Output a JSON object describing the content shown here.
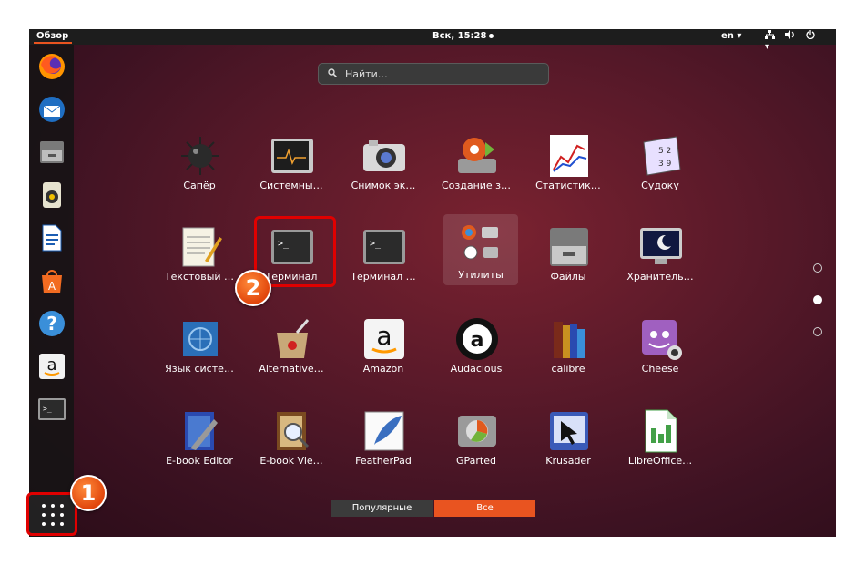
{
  "topbar": {
    "activities": "Обзор",
    "clock": "Вск, 15:28",
    "language": "en ▾",
    "tray_icons": [
      "network-icon",
      "volume-icon",
      "power-icon"
    ]
  },
  "search": {
    "placeholder": "Найти…"
  },
  "dock": {
    "items": [
      "firefox-icon",
      "thunderbird-icon",
      "files-icon",
      "rhythmbox-icon",
      "writer-icon",
      "software-center-icon",
      "help-icon",
      "amazon-icon",
      "terminal-icon"
    ]
  },
  "apps": [
    {
      "label": "Сапёр",
      "icon": "mines-icon"
    },
    {
      "label": "Системны…",
      "icon": "system-monitor-icon"
    },
    {
      "label": "Снимок эк…",
      "icon": "screenshot-icon"
    },
    {
      "label": "Создание з…",
      "icon": "startup-disk-icon"
    },
    {
      "label": "Статистик…",
      "icon": "statistics-icon"
    },
    {
      "label": "Судоку",
      "icon": "sudoku-icon"
    },
    {
      "label": "Текстовый …",
      "icon": "text-editor-icon"
    },
    {
      "label": "Терминал",
      "icon": "terminal-icon"
    },
    {
      "label": "Терминал …",
      "icon": "terminal-alt-icon"
    },
    {
      "label": "Утилиты",
      "icon": "utilities-folder-icon"
    },
    {
      "label": "Файлы",
      "icon": "files-icon"
    },
    {
      "label": "Хранитель…",
      "icon": "screensaver-icon"
    },
    {
      "label": "Язык систе…",
      "icon": "language-icon"
    },
    {
      "label": "Alternative…",
      "icon": "alternatives-icon"
    },
    {
      "label": "Amazon",
      "icon": "amazon-icon"
    },
    {
      "label": "Audacious",
      "icon": "audacious-icon"
    },
    {
      "label": "calibre",
      "icon": "calibre-icon"
    },
    {
      "label": "Cheese",
      "icon": "cheese-icon"
    },
    {
      "label": "E-book Editor",
      "icon": "ebook-editor-icon"
    },
    {
      "label": "E-book Vie…",
      "icon": "ebook-viewer-icon"
    },
    {
      "label": "FeatherPad",
      "icon": "featherpad-icon"
    },
    {
      "label": "GParted",
      "icon": "gparted-icon"
    },
    {
      "label": "Krusader",
      "icon": "krusader-icon"
    },
    {
      "label": "LibreOffice…",
      "icon": "libreoffice-calc-icon"
    }
  ],
  "tabs": {
    "frequent": "Популярные",
    "all": "Все"
  },
  "annotations": {
    "badge1": "1",
    "badge2": "2"
  },
  "colors": {
    "accent": "#e95420",
    "highlight": "#e00000"
  }
}
